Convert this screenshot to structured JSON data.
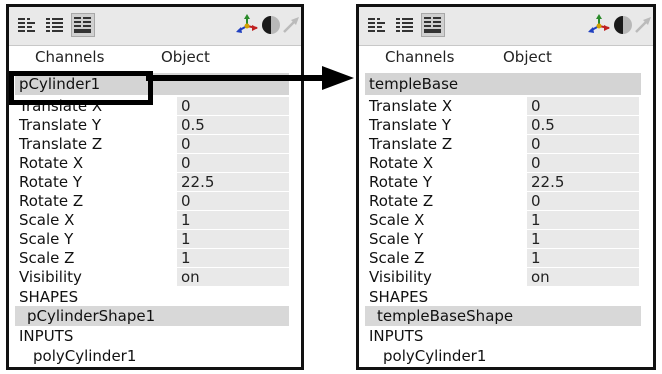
{
  "tabs": {
    "channels": "Channels",
    "object": "Object"
  },
  "left_panel": {
    "header": "pCylinder1",
    "attributes": [
      {
        "label": "Translate X",
        "value": "0"
      },
      {
        "label": "Translate Y",
        "value": "0.5"
      },
      {
        "label": "Translate Z",
        "value": "0"
      },
      {
        "label": "Rotate X",
        "value": "0"
      },
      {
        "label": "Rotate Y",
        "value": "22.5"
      },
      {
        "label": "Rotate Z",
        "value": "0"
      },
      {
        "label": "Scale X",
        "value": "1"
      },
      {
        "label": "Scale Y",
        "value": "1"
      },
      {
        "label": "Scale Z",
        "value": "1"
      },
      {
        "label": "Visibility",
        "value": "on"
      }
    ],
    "shapes_header": "SHAPES",
    "shape_node": "pCylinderShape1",
    "inputs_header": "INPUTS",
    "input_node": "polyCylinder1"
  },
  "right_panel": {
    "header": "templeBase",
    "attributes": [
      {
        "label": "Translate X",
        "value": "0"
      },
      {
        "label": "Translate Y",
        "value": "0.5"
      },
      {
        "label": "Translate Z",
        "value": "0"
      },
      {
        "label": "Rotate X",
        "value": "0"
      },
      {
        "label": "Rotate Y",
        "value": "22.5"
      },
      {
        "label": "Rotate Z",
        "value": "0"
      },
      {
        "label": "Scale X",
        "value": "1"
      },
      {
        "label": "Scale Y",
        "value": "1"
      },
      {
        "label": "Scale Z",
        "value": "1"
      },
      {
        "label": "Visibility",
        "value": "on"
      }
    ],
    "shapes_header": "SHAPES",
    "shape_node": "templeBaseShape",
    "inputs_header": "INPUTS",
    "input_node": "polyCylinder1"
  },
  "icons": [
    "channel-box-icon",
    "layer-editor-icon",
    "channel-layer-icon",
    "axis-manipulator-icon",
    "shading-sphere-icon",
    "arrow-pointer-icon"
  ]
}
